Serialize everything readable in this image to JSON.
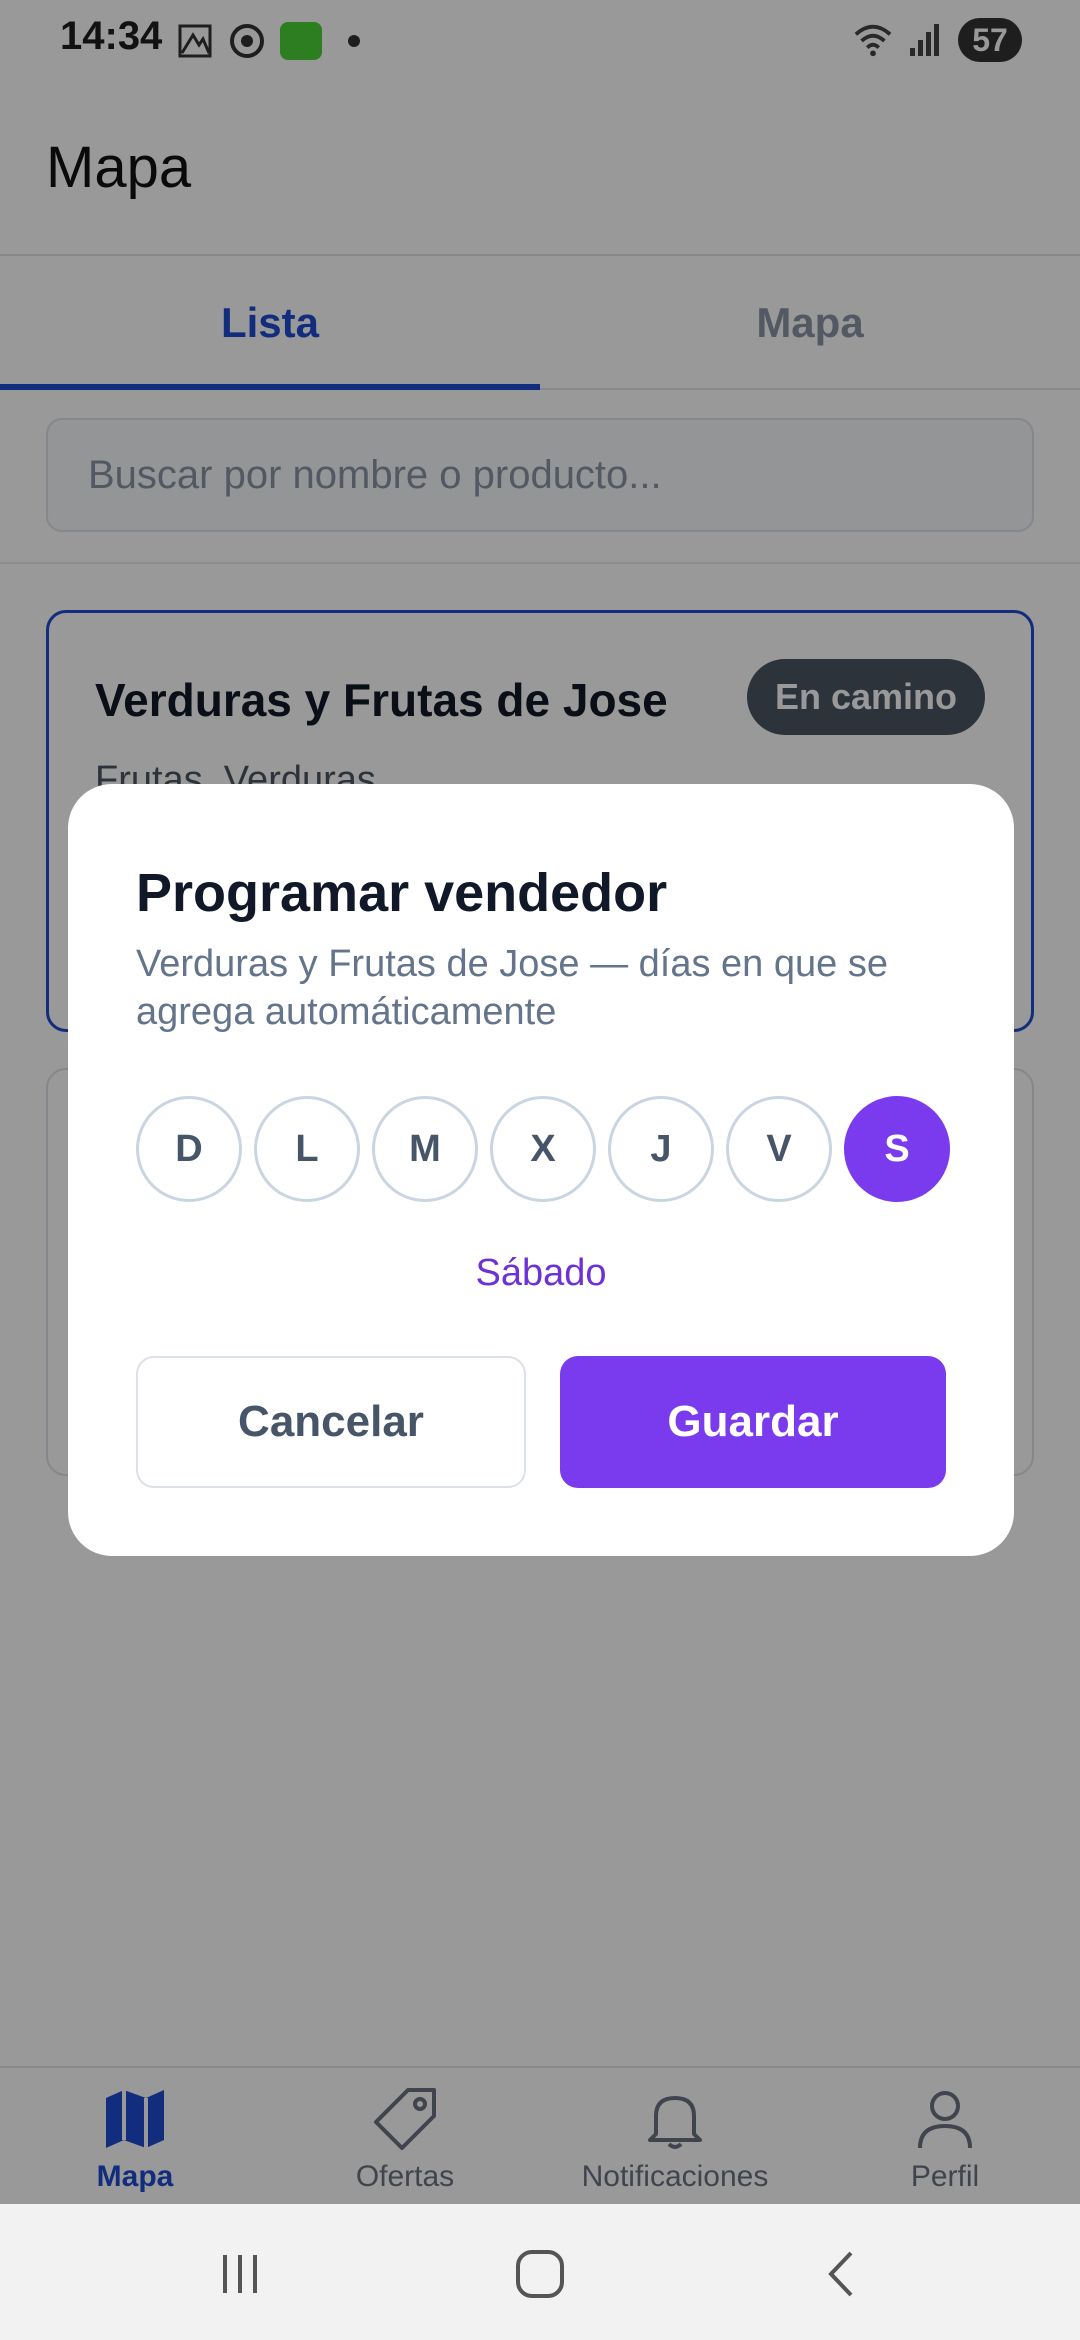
{
  "status_bar": {
    "time": "14:34",
    "battery": "57"
  },
  "app_bar": {
    "title": "Mapa"
  },
  "tabs": [
    {
      "label": "Lista"
    },
    {
      "label": "Mapa"
    }
  ],
  "search": {
    "placeholder": "Buscar por nombre o producto..."
  },
  "vendor_card": {
    "name": "Verduras y Frutas de Jose",
    "status": "En camino",
    "categories": "Frutas, Verduras"
  },
  "dialog": {
    "title": "Programar vendedor",
    "subtitle": "Verduras y Frutas de Jose — días en que se agrega automáticamente",
    "days": [
      "D",
      "L",
      "M",
      "X",
      "J",
      "V",
      "S"
    ],
    "selected_day_label": "Sábado",
    "cancel_label": "Cancelar",
    "save_label": "Guardar"
  },
  "bottom_nav": {
    "items": [
      {
        "label": "Mapa",
        "icon": "map-icon"
      },
      {
        "label": "Ofertas",
        "icon": "tag-icon"
      },
      {
        "label": "Notificaciones",
        "icon": "bell-icon"
      },
      {
        "label": "Perfil",
        "icon": "user-icon"
      }
    ]
  },
  "colors": {
    "primary_blue": "#1e4bd1",
    "accent_purple": "#7a3aed"
  }
}
